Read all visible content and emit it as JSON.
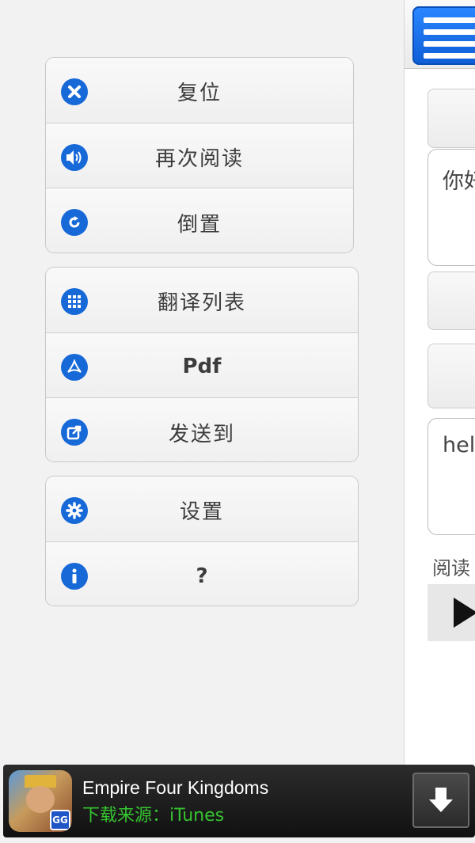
{
  "menu": {
    "group1": [
      {
        "label": "复位",
        "icon": "close-circle-icon"
      },
      {
        "label": "再次阅读",
        "icon": "speaker-icon"
      },
      {
        "label": "倒置",
        "icon": "refresh-icon"
      }
    ],
    "group2": [
      {
        "label": "翻译列表",
        "icon": "grid-icon"
      },
      {
        "label": "Pdf",
        "icon": "pdf-icon"
      },
      {
        "label": "发送到",
        "icon": "share-icon"
      }
    ],
    "group3": [
      {
        "label": "设置",
        "icon": "gear-icon"
      },
      {
        "label": "?",
        "icon": "info-icon"
      }
    ]
  },
  "main": {
    "source_text": "你好",
    "translated_text": "hello",
    "read_label": "阅读"
  },
  "ad": {
    "title": "Empire Four Kingdoms",
    "source": "下载来源：iTunes",
    "badge": "GG"
  },
  "colors": {
    "accent": "#1769d8",
    "menu_button": "#1a73ea",
    "ad_source": "#35c42f"
  }
}
